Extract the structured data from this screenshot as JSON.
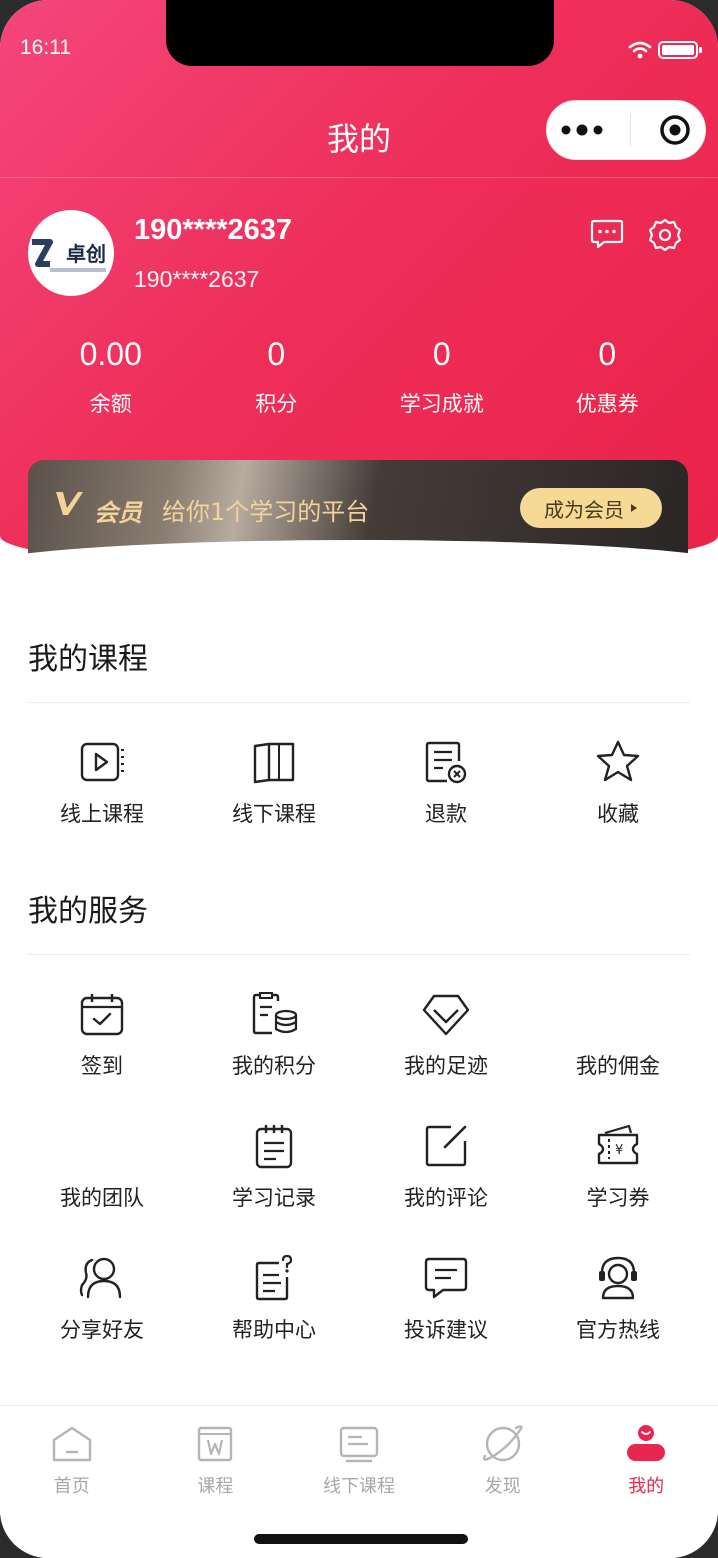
{
  "status": {
    "time": "16:11"
  },
  "nav": {
    "title": "我的"
  },
  "user": {
    "name": "190****2637",
    "phone": "190****2637",
    "avatar_text": "卓创"
  },
  "stats": [
    {
      "value": "0.00",
      "label": "余额"
    },
    {
      "value": "0",
      "label": "积分"
    },
    {
      "value": "0",
      "label": "学习成就"
    },
    {
      "value": "0",
      "label": "优惠券"
    }
  ],
  "vip": {
    "badge": "会员",
    "slogan": "给你1个学习的平台",
    "button": "成为会员"
  },
  "courses": {
    "title": "我的课程",
    "items": [
      {
        "label": "线上课程",
        "icon": "video-icon"
      },
      {
        "label": "线下课程",
        "icon": "book-icon"
      },
      {
        "label": "退款",
        "icon": "refund-icon"
      },
      {
        "label": "收藏",
        "icon": "star-icon"
      }
    ]
  },
  "services": {
    "title": "我的服务",
    "items": [
      {
        "label": "签到",
        "icon": "calendar-check-icon"
      },
      {
        "label": "我的积分",
        "icon": "points-icon"
      },
      {
        "label": "我的足迹",
        "icon": "diamond-icon"
      },
      {
        "label": "我的佣金",
        "icon": ""
      },
      {
        "label": "我的团队",
        "icon": ""
      },
      {
        "label": "学习记录",
        "icon": "clipboard-icon"
      },
      {
        "label": "我的评论",
        "icon": "edit-icon"
      },
      {
        "label": "学习券",
        "icon": "ticket-icon"
      },
      {
        "label": "分享好友",
        "icon": "users-icon"
      },
      {
        "label": "帮助中心",
        "icon": "help-doc-icon"
      },
      {
        "label": "投诉建议",
        "icon": "message-icon"
      },
      {
        "label": "官方热线",
        "icon": "headset-icon"
      }
    ]
  },
  "tabbar": [
    {
      "label": "首页",
      "icon": "home-icon",
      "active": false
    },
    {
      "label": "课程",
      "icon": "course-icon",
      "active": false
    },
    {
      "label": "线下课程",
      "icon": "offline-icon",
      "active": false
    },
    {
      "label": "发现",
      "icon": "planet-icon",
      "active": false
    },
    {
      "label": "我的",
      "icon": "profile-icon",
      "active": true
    }
  ],
  "colors": {
    "primary": "#ee2f5a",
    "gold": "#f3d39a",
    "inactive": "#a8a8a8"
  }
}
